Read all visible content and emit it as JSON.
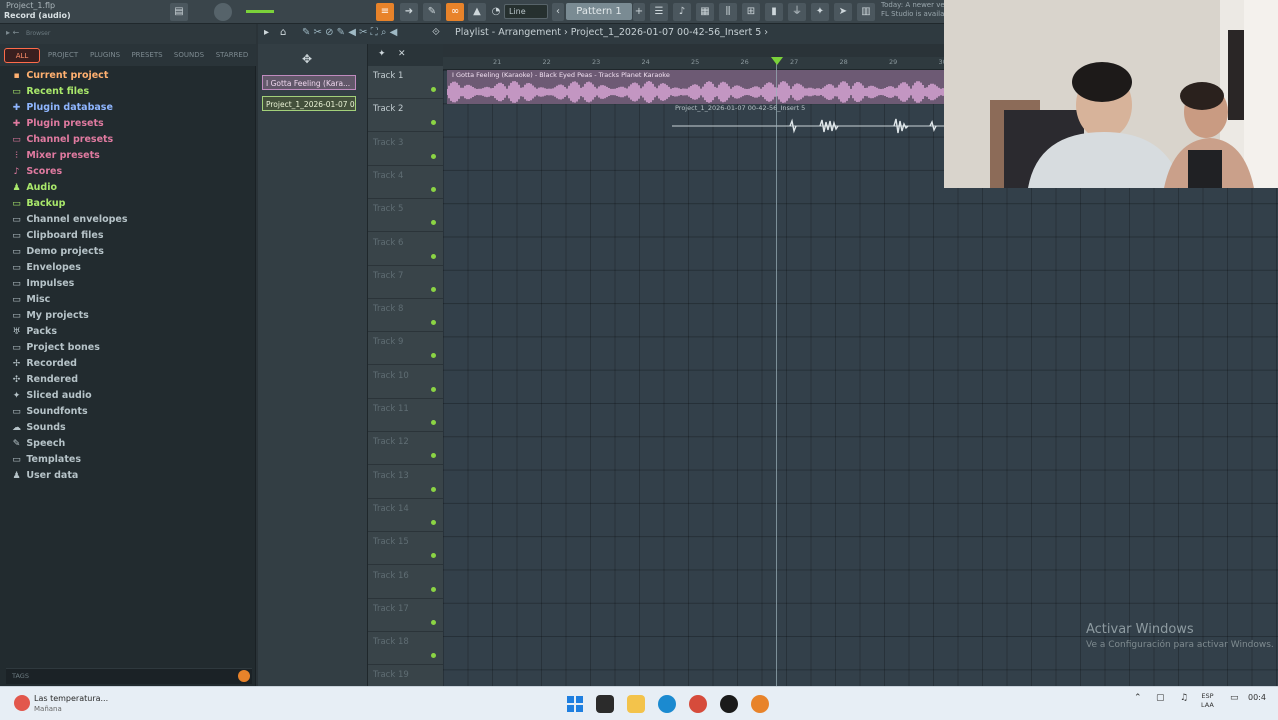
{
  "window": {
    "project_file": "Project_1.flp",
    "record_label": "Record (audio)"
  },
  "toolbar": {
    "line_mode": "Line",
    "pattern": "Pattern 1",
    "hint_line1": "Today: A newer ve...",
    "hint_line2": "FL Studio is availa..."
  },
  "browser": {
    "header_label": "Browser",
    "tabs": [
      "ALL",
      "PROJECT",
      "PLUGINS",
      "PRESETS",
      "SOUNDS",
      "STARRED"
    ],
    "items": [
      {
        "label": "Current project",
        "icon": "project-icon"
      },
      {
        "label": "Recent files",
        "icon": "recent-folder-icon"
      },
      {
        "label": "Plugin database",
        "icon": "plugin-icon"
      },
      {
        "label": "Plugin presets",
        "icon": "plugin-icon"
      },
      {
        "label": "Channel presets",
        "icon": "channel-icon"
      },
      {
        "label": "Mixer presets",
        "icon": "mixer-icon"
      },
      {
        "label": "Scores",
        "icon": "note-icon"
      },
      {
        "label": "Audio",
        "icon": "user-icon"
      },
      {
        "label": "Backup",
        "icon": "backup-folder-icon"
      },
      {
        "label": "Channel envelopes",
        "icon": "folder-icon"
      },
      {
        "label": "Clipboard files",
        "icon": "folder-icon"
      },
      {
        "label": "Demo projects",
        "icon": "folder-icon"
      },
      {
        "label": "Envelopes",
        "icon": "folder-icon"
      },
      {
        "label": "Impulses",
        "icon": "folder-icon"
      },
      {
        "label": "Misc",
        "icon": "folder-icon"
      },
      {
        "label": "My projects",
        "icon": "folder-icon"
      },
      {
        "label": "Packs",
        "icon": "packs-icon"
      },
      {
        "label": "Project bones",
        "icon": "folder-icon"
      },
      {
        "label": "Recorded",
        "icon": "record-icon"
      },
      {
        "label": "Rendered",
        "icon": "render-icon"
      },
      {
        "label": "Sliced audio",
        "icon": "slice-icon"
      },
      {
        "label": "Soundfonts",
        "icon": "folder-icon"
      },
      {
        "label": "Sounds",
        "icon": "cloud-icon"
      },
      {
        "label": "Speech",
        "icon": "speech-icon"
      },
      {
        "label": "Templates",
        "icon": "folder-icon"
      },
      {
        "label": "User data",
        "icon": "user-icon"
      }
    ],
    "tags_label": "TAGS"
  },
  "playlist": {
    "title": "Playlist - Arrangement  ›  Project_1_2026-01-07 00-42-56_Insert 5  ›",
    "clip_names": [
      "I Gotta Feeling (Kara...",
      "Project_1_2026-01-07 0..."
    ],
    "tracks": [
      "Track 1",
      "Track 2",
      "Track 3",
      "Track 4",
      "Track 5",
      "Track 6",
      "Track 7",
      "Track 8",
      "Track 9",
      "Track 10",
      "Track 11",
      "Track 12",
      "Track 13",
      "Track 14",
      "Track 15",
      "Track 16",
      "Track 17",
      "Track 18",
      "Track 19"
    ],
    "ruler_marks": [
      "21",
      "22",
      "23",
      "24",
      "25",
      "26",
      "27",
      "28",
      "29",
      "30"
    ],
    "clip1_title": "I Gotta Feeling (Karaoke) - Black Eyed Peas - Tracks Planet Karaoke",
    "clip2_title": "Project_1_2026-01-07 00-42-56_Insert 5"
  },
  "activation": {
    "title": "Activar Windows",
    "subtitle": "Ve a Configuración para activar Windows."
  },
  "taskbar": {
    "weather_line1": "Las temperatura...",
    "weather_line2": "Mañana",
    "lang1": "ESP",
    "lang2": "LAA",
    "time": "00:4"
  },
  "colors": {
    "accent": "#e8832a",
    "clip_pink": "#d9a6d6",
    "led_green": "#8bd444",
    "active_tab": "#ff6b4a"
  }
}
